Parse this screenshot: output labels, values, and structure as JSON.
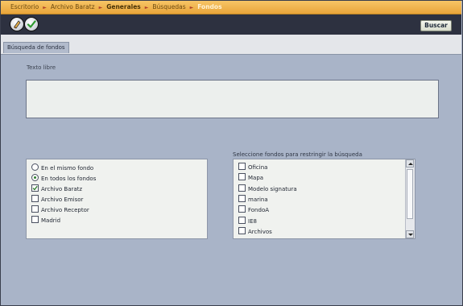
{
  "breadcrumb": [
    {
      "label": "Escritorio",
      "style": "normal"
    },
    {
      "label": "Archivo Baratz",
      "style": "normal"
    },
    {
      "label": "Generales",
      "style": "bold"
    },
    {
      "label": "Búsquedas",
      "style": "normal"
    },
    {
      "label": "Fondos",
      "style": "last"
    }
  ],
  "breadcrumb_separator": "►",
  "toolbar": {
    "buscar_label": "Buscar",
    "icons": [
      "eraser-icon",
      "check-icon"
    ]
  },
  "tab": {
    "label": "Búsqueda de fondos"
  },
  "form": {
    "texto_label": "Texto libre",
    "texto_value": "",
    "left_options": [
      {
        "type": "radio",
        "label": "En el mismo fondo",
        "checked": false
      },
      {
        "type": "radio",
        "label": "En todos los fondos",
        "checked": true
      },
      {
        "type": "checkbox",
        "label": "Archivo Baratz",
        "checked": true
      },
      {
        "type": "checkbox",
        "label": "Archivo Emisor",
        "checked": false
      },
      {
        "type": "checkbox",
        "label": "Archivo Receptor",
        "checked": false
      },
      {
        "type": "checkbox",
        "label": "Madrid",
        "checked": false
      }
    ],
    "select_label": "Seleccione fondos para restringir la búsqueda",
    "fondos": [
      {
        "label": "Oficina",
        "checked": false
      },
      {
        "label": "Mapa",
        "checked": false
      },
      {
        "label": "Modelo signatura",
        "checked": false
      },
      {
        "label": "marina",
        "checked": false
      },
      {
        "label": "FondoA",
        "checked": false
      },
      {
        "label": "IE8",
        "checked": false
      },
      {
        "label": "Archivos",
        "checked": false
      }
    ]
  },
  "colors": {
    "accent": "#e9a53a",
    "toolbar": "#2d3140",
    "content_bg": "#a9b4c8",
    "check": "#2e7d2e"
  }
}
